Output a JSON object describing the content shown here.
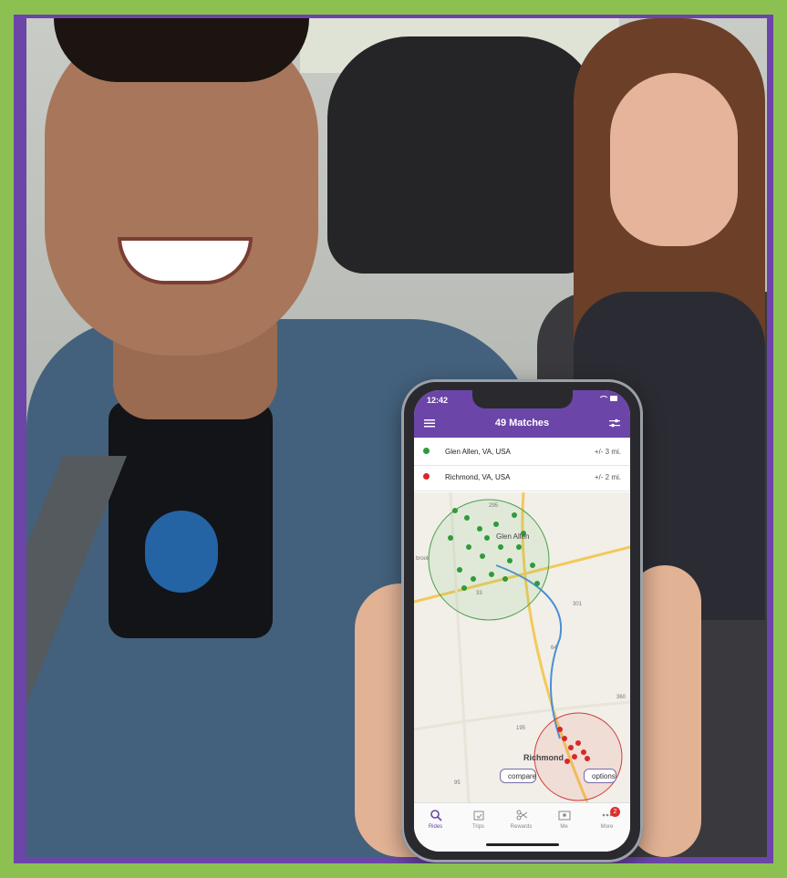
{
  "photo": {
    "border_color": "#8cc152",
    "frame_color": "#6b45a8",
    "description_icons": [
      "driver-figure",
      "passenger-figure",
      "hand-holding-phone"
    ]
  },
  "phone": {
    "status": {
      "time": "12:42",
      "location_arrow": "location-icon",
      "icons": [
        "wifi-icon",
        "battery-icon"
      ]
    },
    "header": {
      "title": "49 Matches",
      "left_icon": "menu-icon",
      "right_icon": "filter-icon",
      "color": "#6b45a8"
    },
    "locations": [
      {
        "name": "Glen Allen, VA, USA",
        "radius": "+/- 3 mi.",
        "color": "#2e9b3a"
      },
      {
        "name": "Richmond, VA, USA",
        "radius": "+/- 2 mi.",
        "color": "#d62828"
      }
    ],
    "map": {
      "labels": {
        "glen_allen": "Glen Allen",
        "richmond": "Richmond",
        "brook": "brook",
        "r295": "295",
        "r95": "95",
        "r33": "33",
        "r301": "301",
        "r64": "64",
        "r195": "195",
        "r360": "360"
      },
      "buttons": {
        "compare": "compare",
        "options": "options"
      }
    },
    "tabs": [
      {
        "label": "Rides",
        "icon": "search-icon",
        "active": true
      },
      {
        "label": "Trips",
        "icon": "calendar-icon",
        "active": false
      },
      {
        "label": "Rewards",
        "icon": "scissors-icon",
        "active": false
      },
      {
        "label": "Me",
        "icon": "id-card-icon",
        "active": false
      },
      {
        "label": "More",
        "icon": "more-icon",
        "active": false
      }
    ],
    "more_badge": "2"
  }
}
